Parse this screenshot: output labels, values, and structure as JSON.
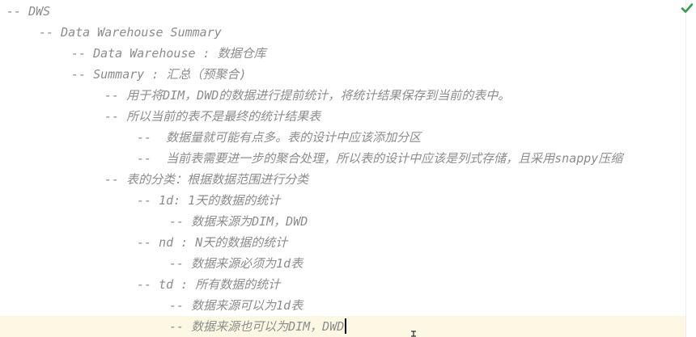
{
  "colors": {
    "comment": "#8c8c8c",
    "current_line": "#fcf8e3",
    "check": "#3d9a48",
    "caret": "#000000"
  },
  "status": {
    "icon": "check-icon"
  },
  "lines": [
    "-- DWS",
    "-- Data Warehouse Summary",
    "-- Data Warehouse : 数据仓库",
    "-- Summary : 汇总（预聚合)",
    "-- 用于将DIM，DWD的数据进行提前统计，将统计结果保存到当前的表中。",
    "-- 所以当前的表不是最终的统计结果表",
    "--  数据量就可能有点多。表的设计中应该添加分区",
    "--  当前表需要进一步的聚合处理，所以表的设计中应该是列式存储，且采用snappy压缩",
    "-- 表的分类：根据数据范围进行分类",
    "-- 1d: 1天的数据的统计",
    "-- 数据来源为DIM，DWD",
    "-- nd : N天的数据的统计",
    "-- 数据来源必须为1d表",
    "-- td : 所有数据的统计",
    "-- 数据来源可以为1d表",
    "-- 数据来源也可以为DIM，DWD"
  ]
}
